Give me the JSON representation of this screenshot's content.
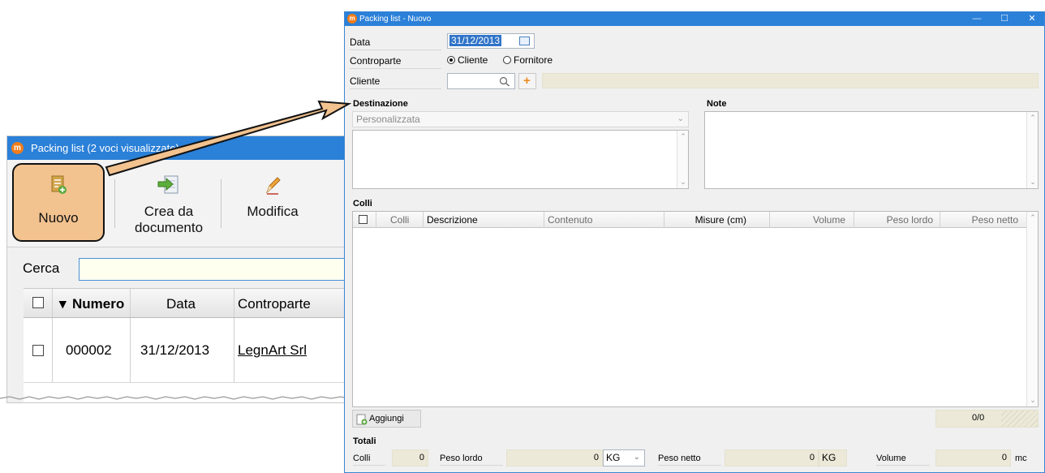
{
  "back_window": {
    "title": "Packing list (2 voci visualizzate)",
    "toolbar": {
      "new_label": "Nuovo",
      "create_from_doc_label_line1": "Crea da",
      "create_from_doc_label_line2": "documento",
      "edit_label": "Modifica"
    },
    "search": {
      "label": "Cerca",
      "value": ""
    },
    "grid": {
      "columns": [
        "Numero",
        "Data",
        "Controparte"
      ],
      "rows": [
        {
          "numero": "000002",
          "data": "31/12/2013",
          "controparte": "LegnArt Srl"
        }
      ]
    }
  },
  "dialog": {
    "title": "Packing list - Nuovo",
    "fields": {
      "data_label": "Data",
      "data_value": "31/12/2013",
      "controparte_label": "Controparte",
      "option_cliente": "Cliente",
      "option_fornitore": "Fornitore",
      "selected_option": "Cliente",
      "cliente_label": "Cliente",
      "cliente_value": ""
    },
    "destinazione": {
      "section_title": "Destinazione",
      "selected": "Personalizzata",
      "text": ""
    },
    "note": {
      "section_title": "Note",
      "text": ""
    },
    "colli": {
      "section_title": "Colli",
      "columns": [
        "Colli",
        "Descrizione",
        "Contenuto",
        "Misure (cm)",
        "Volume",
        "Peso lordo",
        "Peso netto"
      ],
      "rows": [],
      "add_button": "Aggiungi",
      "counter": "0/0"
    },
    "totali": {
      "section_title": "Totali",
      "colli_label": "Colli",
      "colli_value": "0",
      "peso_lordo_label": "Peso lordo",
      "peso_lordo_value": "0",
      "peso_lordo_unit": "KG",
      "peso_netto_label": "Peso netto",
      "peso_netto_value": "0",
      "peso_netto_unit": "KG",
      "volume_label": "Volume",
      "volume_value": "0",
      "volume_unit": "mc"
    }
  },
  "colors": {
    "titlebar": "#2b80d8",
    "highlight_button": "#f2c28f",
    "readonly_field": "#ece9d8",
    "search_field": "#fffff0",
    "arrow_fill": "#f2c28f"
  }
}
